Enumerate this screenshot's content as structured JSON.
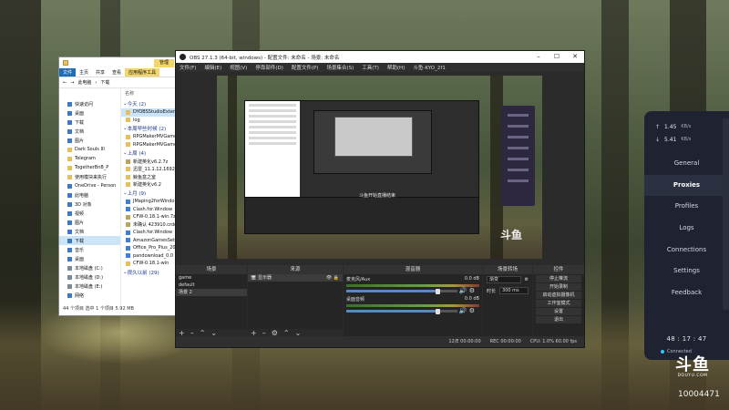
{
  "explorer": {
    "manage_tab": "管理",
    "ribbon": [
      "文件",
      "主页",
      "共享",
      "查看",
      "应用程序工具"
    ],
    "path": [
      "此电脑",
      "下载"
    ],
    "nav": [
      {
        "label": "快速访问",
        "icon": "star-icon"
      },
      {
        "label": "桌面",
        "icon": "desktop-icon"
      },
      {
        "label": "下载",
        "icon": "download-icon"
      },
      {
        "label": "文档",
        "icon": "document-icon"
      },
      {
        "label": "图片",
        "icon": "picture-icon"
      },
      {
        "label": "Dark Souls III",
        "icon": "folder-icon"
      },
      {
        "label": "Telegram",
        "icon": "folder-icon"
      },
      {
        "label": "TogetherBnB_P",
        "icon": "folder-icon"
      },
      {
        "label": "使用模块来执行",
        "icon": "folder-icon"
      },
      {
        "label": "OneDrive - Person",
        "icon": "cloud-icon"
      },
      {
        "label": "此电脑",
        "icon": "pc-icon"
      },
      {
        "label": "3D 对象",
        "icon": "cube-icon"
      },
      {
        "label": "视频",
        "icon": "video-icon"
      },
      {
        "label": "图片",
        "icon": "picture-icon"
      },
      {
        "label": "文档",
        "icon": "document-icon"
      },
      {
        "label": "下载",
        "icon": "download-icon"
      },
      {
        "label": "音乐",
        "icon": "music-icon"
      },
      {
        "label": "桌面",
        "icon": "desktop-icon"
      },
      {
        "label": "本地磁盘 (C:)",
        "icon": "drive-icon"
      },
      {
        "label": "本地磁盘 (D:)",
        "icon": "drive-icon"
      },
      {
        "label": "本地磁盘 (E:)",
        "icon": "drive-icon"
      },
      {
        "label": "网络",
        "icon": "network-icon"
      }
    ],
    "column_header": "名称",
    "groups": [
      {
        "label": "今天 (2)",
        "files": [
          "DYOBSStudioExten",
          "log"
        ]
      },
      {
        "label": "本周早些时候 (2)",
        "files": [
          "RPGMakerMVGame",
          "RPGMakerMVGame"
        ]
      },
      {
        "label": "上周 (4)",
        "files": [
          "新建英化v6.2.7z",
          "迅雷_11.1.12.1692_",
          "鲸鱼盒之室",
          "新建英化v6.2"
        ]
      },
      {
        "label": "上月 (9)",
        "files": [
          "JMaping2forWindo",
          "Clash.for.Window",
          "CFW-0.18.1-win.7z",
          "未确认 423910.crdo",
          "Clash.for.Window",
          "AmazonGamesSet",
          "Office_Pro_Plus_20",
          "pandownload_0.0",
          "CFW-0.18.1-win"
        ]
      },
      {
        "label": "很久以前 (29)",
        "files": []
      }
    ],
    "status": "44 个项目   选中 1 个项目  5.92 MB"
  },
  "obs": {
    "title": "OBS 27.1.3 (64-bit, windows) - 配置文件: 未命名 - 场景: 未命名",
    "menu": [
      "文件(F)",
      "编辑(E)",
      "视图(V)",
      "停靠部件(D)",
      "配置文件(P)",
      "场景集合(S)",
      "工具(T)",
      "帮助(H)",
      "斗鱼-KYO_2f1"
    ],
    "preview_toast": "斗鱼开始直播结束",
    "transition_tabs": [
      "⏺ 混音器",
      "⚙"
    ],
    "docks": {
      "scenes": {
        "title": "场景",
        "items": [
          "game",
          "default",
          "场景 2"
        ]
      },
      "sources": {
        "title": "来源",
        "items": [
          "显示器"
        ]
      },
      "mixer": {
        "title": "混音器",
        "channels": [
          {
            "name": "麦克风/Aux",
            "db": "0.0 dB",
            "level": 0.82
          },
          {
            "name": "桌面音频",
            "db": "0.0 dB",
            "level": 0.82
          }
        ]
      },
      "transitions": {
        "title": "场景转场",
        "type": "渐变",
        "duration_label": "时长",
        "duration": "300 ms"
      },
      "controls": {
        "title": "控件",
        "buttons": [
          "停止推流",
          "开始录制",
          "启动虚拟摄像机",
          "工作室模式",
          "设置",
          "退出"
        ]
      }
    },
    "status": [
      "12/E  00:00:00",
      "REC  00:00:00",
      "CPU: 1.0%  60.00 fps"
    ]
  },
  "stats": {
    "upload": {
      "value": "1.45",
      "unit": "KB/s"
    },
    "download": {
      "value": "5.41",
      "unit": "KB/s"
    },
    "menu": [
      "General",
      "Proxies",
      "Profiles",
      "Logs",
      "Connections",
      "Settings",
      "Feedback"
    ],
    "active_index": 1,
    "clock": "48 : 17 : 47",
    "connection": "Connected"
  },
  "watermark": {
    "logo": "斗鱼",
    "url": "DOUYU.COM",
    "room_id": "10004471"
  }
}
